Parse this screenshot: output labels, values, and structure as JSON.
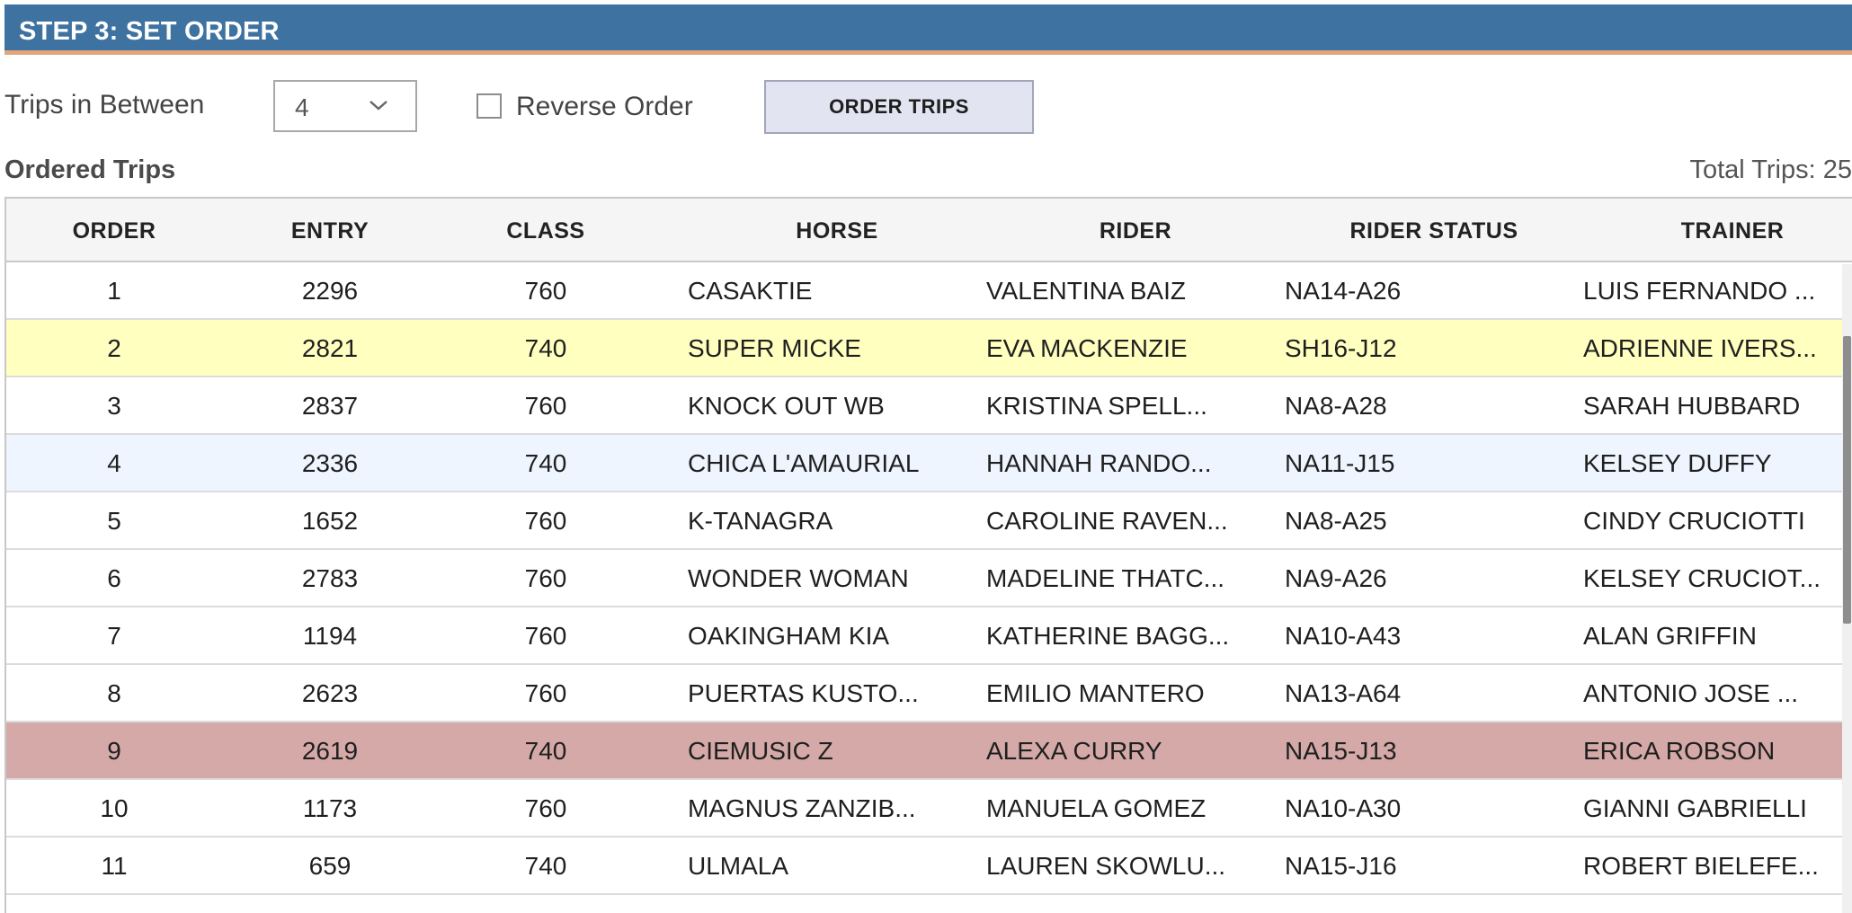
{
  "header": {
    "title": "STEP 3: SET ORDER"
  },
  "controls": {
    "trips_label": "Trips in Between",
    "trips_value": "4",
    "reverse_label": "Reverse Order",
    "order_button": "ORDER TRIPS"
  },
  "section": {
    "title": "Ordered Trips",
    "total_label": "Total Trips: 25"
  },
  "colors": {
    "header_bg": "#3d72a1",
    "header_accent": "#e3a57a",
    "row_highlight_yellow": "#ffffbf",
    "row_highlight_blue": "#eef5fe",
    "row_highlight_red": "#d4a9a8"
  },
  "table": {
    "columns": [
      "ORDER",
      "ENTRY",
      "CLASS",
      "HORSE",
      "RIDER",
      "RIDER STATUS",
      "TRAINER"
    ],
    "rows": [
      {
        "order": "1",
        "entry": "2296",
        "class": "760",
        "horse": "CASAKTIE",
        "rider": "VALENTINA BAIZ",
        "status": "NA14-A26",
        "trainer": "LUIS FERNANDO ...",
        "highlight": "none"
      },
      {
        "order": "2",
        "entry": "2821",
        "class": "740",
        "horse": "SUPER MICKE",
        "rider": "EVA MACKENZIE",
        "status": "SH16-J12",
        "trainer": "ADRIENNE IVERS...",
        "highlight": "yellow"
      },
      {
        "order": "3",
        "entry": "2837",
        "class": "760",
        "horse": "KNOCK OUT WB",
        "rider": "KRISTINA SPELL...",
        "status": "NA8-A28",
        "trainer": "SARAH HUBBARD",
        "highlight": "none"
      },
      {
        "order": "4",
        "entry": "2336",
        "class": "740",
        "horse": "CHICA L'AMAURIAL",
        "rider": "HANNAH RANDO...",
        "status": "NA11-J15",
        "trainer": "KELSEY DUFFY",
        "highlight": "blue"
      },
      {
        "order": "5",
        "entry": "1652",
        "class": "760",
        "horse": "K-TANAGRA",
        "rider": "CAROLINE RAVEN...",
        "status": "NA8-A25",
        "trainer": "CINDY CRUCIOTTI",
        "highlight": "none"
      },
      {
        "order": "6",
        "entry": "2783",
        "class": "760",
        "horse": "WONDER WOMAN",
        "rider": "MADELINE THATC...",
        "status": "NA9-A26",
        "trainer": "KELSEY CRUCIOT...",
        "highlight": "none"
      },
      {
        "order": "7",
        "entry": "1194",
        "class": "760",
        "horse": "OAKINGHAM KIA",
        "rider": "KATHERINE BAGG...",
        "status": "NA10-A43",
        "trainer": "ALAN GRIFFIN",
        "highlight": "none"
      },
      {
        "order": "8",
        "entry": "2623",
        "class": "760",
        "horse": "PUERTAS KUSTO...",
        "rider": "EMILIO MANTERO",
        "status": "NA13-A64",
        "trainer": "ANTONIO JOSE ...",
        "highlight": "none"
      },
      {
        "order": "9",
        "entry": "2619",
        "class": "740",
        "horse": "CIEMUSIC Z",
        "rider": "ALEXA CURRY",
        "status": "NA15-J13",
        "trainer": "ERICA ROBSON",
        "highlight": "red"
      },
      {
        "order": "10",
        "entry": "1173",
        "class": "760",
        "horse": "MAGNUS ZANZIB...",
        "rider": "MANUELA GOMEZ",
        "status": "NA10-A30",
        "trainer": "GIANNI GABRIELLI",
        "highlight": "none"
      },
      {
        "order": "11",
        "entry": "659",
        "class": "740",
        "horse": "ULMALA",
        "rider": "LAUREN SKOWLU...",
        "status": "NA15-J16",
        "trainer": "ROBERT BIELEFE...",
        "highlight": "none"
      }
    ]
  }
}
